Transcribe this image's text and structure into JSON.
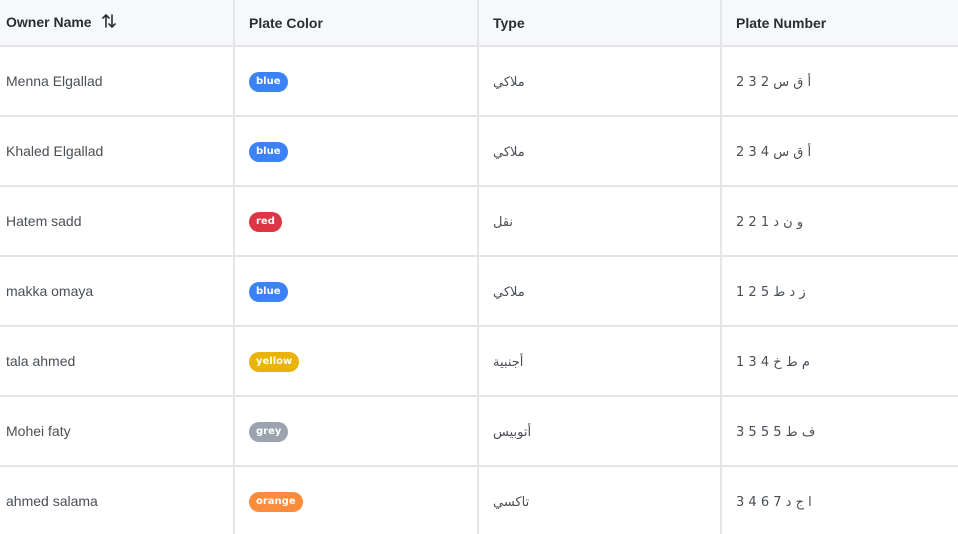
{
  "header": {
    "owner_name": "Owner Name",
    "plate_color": "Plate Color",
    "type": "Type",
    "plate_number": "Plate Number",
    "sort_icon": "sort-arrows-icon"
  },
  "colors": {
    "blue": "#3b82f6",
    "red": "#dc3545",
    "yellow": "#eab308",
    "grey": "#9ca3af",
    "orange": "#fb8c3c"
  },
  "rows": [
    {
      "owner": "Menna Elgallad",
      "color": "blue",
      "type": "ملاكي",
      "plate": "أ ق س 2 3 2"
    },
    {
      "owner": "Khaled Elgallad",
      "color": "blue",
      "type": "ملاكي",
      "plate": "أ ق س 4 3 2"
    },
    {
      "owner": "Hatem sadd",
      "color": "red",
      "type": "نقل",
      "plate": "و ن د 1 2 2"
    },
    {
      "owner": "makka omaya",
      "color": "blue",
      "type": "ملاكي",
      "plate": "ز د ط 5 2 1"
    },
    {
      "owner": "tala ahmed",
      "color": "yellow",
      "type": "أجنبية",
      "plate": "م ط خ 4 3 1"
    },
    {
      "owner": "Mohei faty",
      "color": "grey",
      "type": "أتوبيس",
      "plate": "ف ط 5 5 5 3"
    },
    {
      "owner": "ahmed salama",
      "color": "orange",
      "type": "تاكسي",
      "plate": "ا ج د 7 6 4 3"
    }
  ]
}
